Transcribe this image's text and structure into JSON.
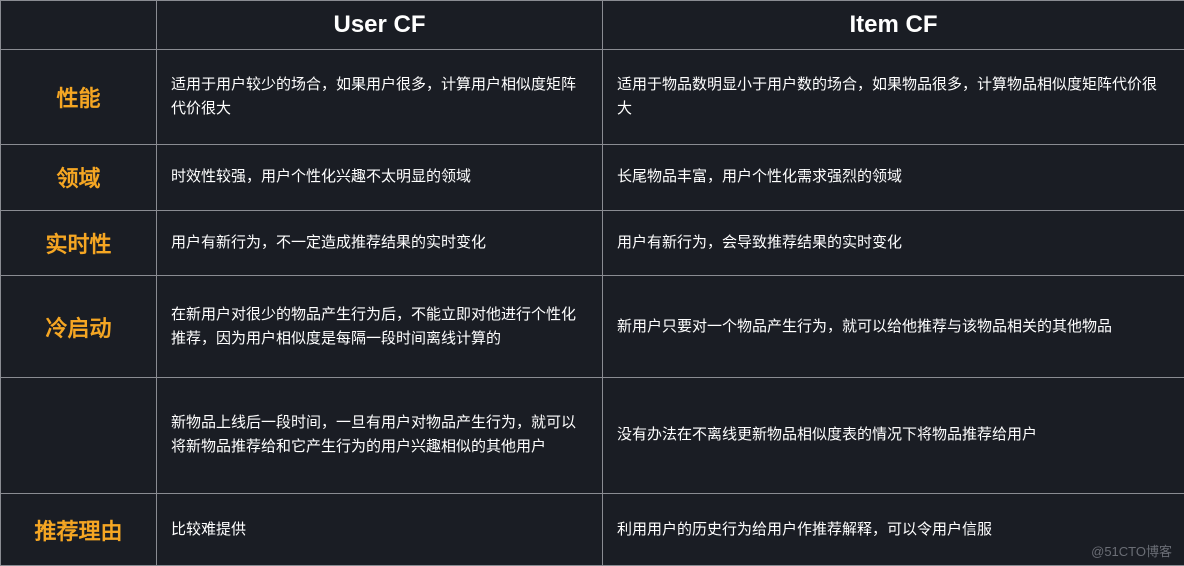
{
  "headers": {
    "col0": "",
    "col1": "User CF",
    "col2": "Item CF"
  },
  "rows": [
    {
      "label": "性能",
      "user": "适用于用户较少的场合，如果用户很多，计算用户相似度矩阵代价很大",
      "item": "适用于物品数明显小于用户数的场合，如果物品很多，计算物品相似度矩阵代价很大"
    },
    {
      "label": "领域",
      "user": "时效性较强，用户个性化兴趣不太明显的领域",
      "item": "长尾物品丰富，用户个性化需求强烈的领域"
    },
    {
      "label": "实时性",
      "user": "用户有新行为，不一定造成推荐结果的实时变化",
      "item": "用户有新行为，会导致推荐结果的实时变化"
    },
    {
      "label": "冷启动",
      "user": "在新用户对很少的物品产生行为后，不能立即对他进行个性化推荐，因为用户相似度是每隔一段时间离线计算的",
      "item": "新用户只要对一个物品产生行为，就可以给他推荐与该物品相关的其他物品"
    },
    {
      "label": "",
      "user": "新物品上线后一段时间，一旦有用户对物品产生行为，就可以将新物品推荐给和它产生行为的用户兴趣相似的其他用户",
      "item": "没有办法在不离线更新物品相似度表的情况下将物品推荐给用户"
    },
    {
      "label": "推荐理由",
      "user": "比较难提供",
      "item": "利用用户的历史行为给用户作推荐解释，可以令用户信服"
    }
  ],
  "watermark": "@51CTO博客"
}
